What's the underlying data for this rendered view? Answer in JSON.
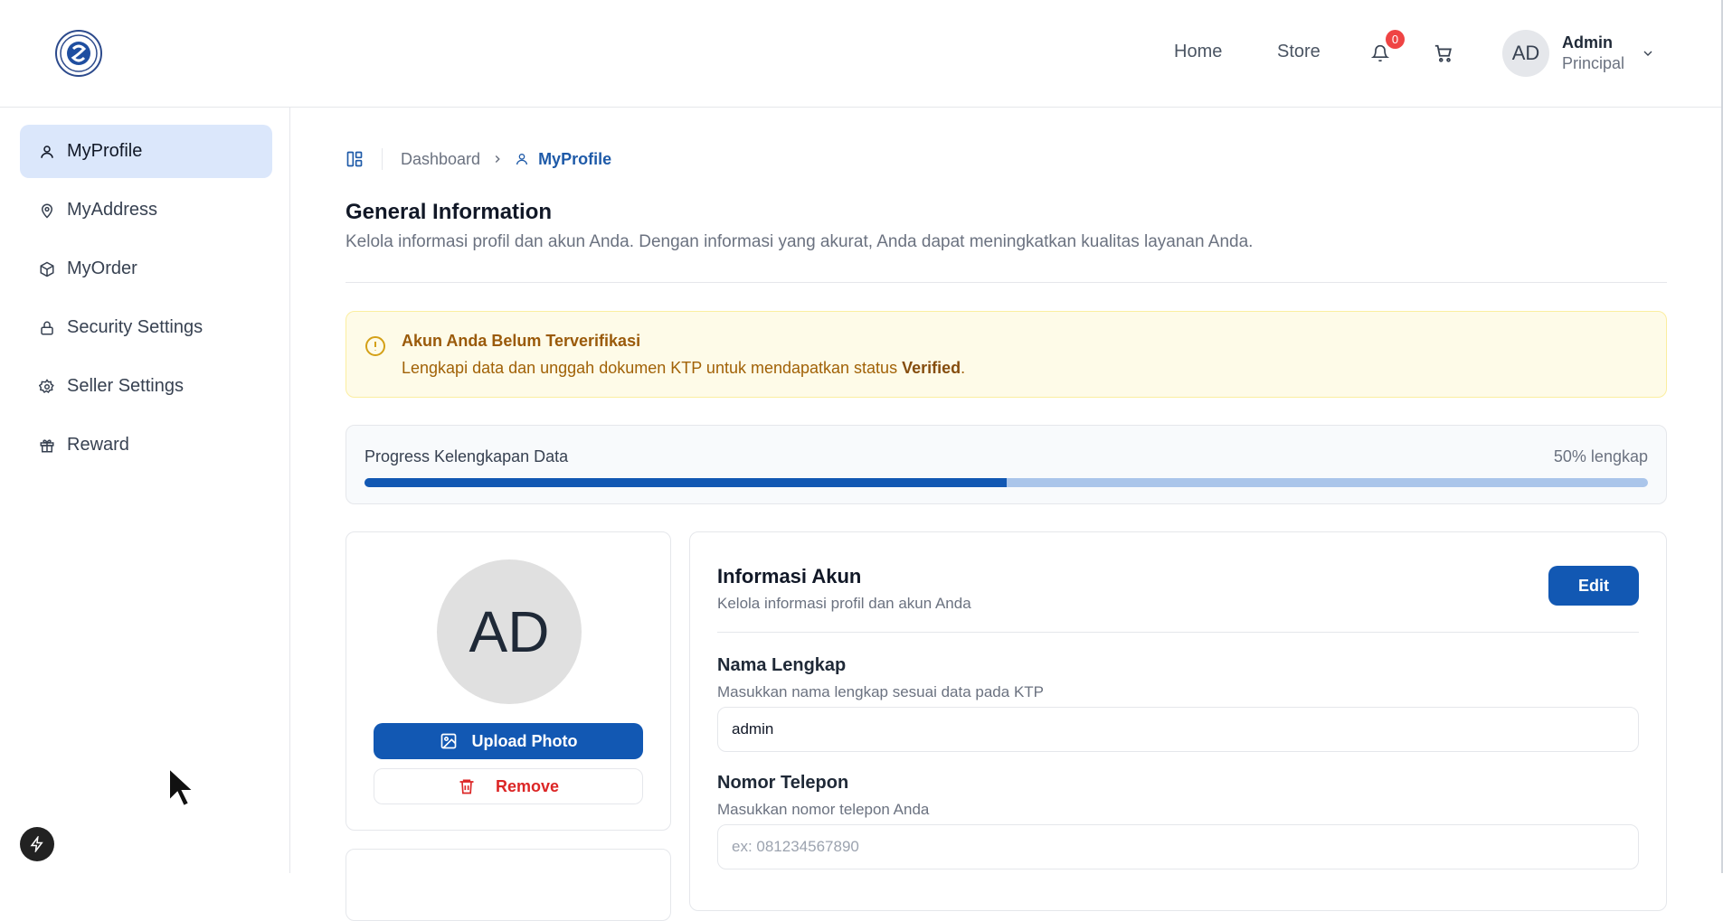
{
  "header": {
    "nav": [
      {
        "label": "Home"
      },
      {
        "label": "Store"
      }
    ],
    "notification_count": "0",
    "user": {
      "initials": "AD",
      "name": "Admin",
      "role": "Principal"
    }
  },
  "sidebar": {
    "items": [
      {
        "label": "MyProfile",
        "icon": "user-icon",
        "active": true
      },
      {
        "label": "MyAddress",
        "icon": "map-pin-icon"
      },
      {
        "label": "MyOrder",
        "icon": "package-icon"
      },
      {
        "label": "Security Settings",
        "icon": "lock-icon"
      },
      {
        "label": "Seller Settings",
        "icon": "gear-icon"
      },
      {
        "label": "Reward",
        "icon": "gift-icon"
      }
    ]
  },
  "breadcrumb": {
    "root": "Dashboard",
    "current": "MyProfile"
  },
  "page": {
    "title": "General Information",
    "subtitle": "Kelola informasi profil dan akun Anda. Dengan informasi yang akurat, Anda dapat meningkatkan kualitas layanan Anda."
  },
  "alert": {
    "title": "Akun Anda Belum Terverifikasi",
    "text_before": "Lengkapi data dan unggah dokumen KTP untuk mendapatkan status ",
    "text_bold": "Verified",
    "text_after": "."
  },
  "progress": {
    "label": "Progress Kelengkapan Data",
    "percent_text": "50% lengkap",
    "fill_fraction": 0.5
  },
  "photo": {
    "initials": "AD",
    "upload_label": "Upload Photo",
    "remove_label": "Remove"
  },
  "account": {
    "title": "Informasi Akun",
    "subtitle": "Kelola informasi profil dan akun Anda",
    "edit_label": "Edit",
    "fields": [
      {
        "label": "Nama Lengkap",
        "help": "Masukkan nama lengkap sesuai data pada KTP",
        "value": "admin",
        "placeholder": ""
      },
      {
        "label": "Nomor Telepon",
        "help": "Masukkan nomor telepon Anda",
        "value": "",
        "placeholder": "ex: 081234567890"
      }
    ]
  },
  "colors": {
    "primary": "#1258b3",
    "active_bg": "#dbe7fb",
    "alert_bg": "#fefbe8",
    "danger": "#dc2626"
  }
}
